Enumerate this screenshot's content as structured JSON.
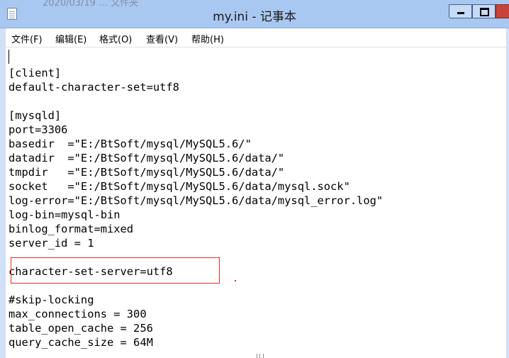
{
  "window": {
    "title": "my.ini - 记事本",
    "ghost_title": "2020/03/19 … 文件夹",
    "icon": "notepad-icon"
  },
  "menu": {
    "items": [
      {
        "label": "文件(F)"
      },
      {
        "label": "编辑(E)"
      },
      {
        "label": "格式(O)"
      },
      {
        "label": "查看(V)"
      },
      {
        "label": "帮助(H)"
      }
    ]
  },
  "editor": {
    "lines": [
      "",
      "[client]",
      "default-character-set=utf8",
      "",
      "[mysqld]",
      "port=3306",
      "basedir  =\"E:/BtSoft/mysql/MySQL5.6/\"",
      "datadir  =\"E:/BtSoft/mysql/MySQL5.6/data/\"",
      "tmpdir   =\"E:/BtSoft/mysql/MySQL5.6/data/\"",
      "socket   =\"E:/BtSoft/mysql/MySQL5.6/data/mysql.sock\"",
      "log-error=\"E:/BtSoft/mysql/MySQL5.6/data/mysql_error.log\"",
      "log-bin=mysql-bin",
      "binlog_format=mixed",
      "server_id = 1",
      "",
      "character-set-server=utf8",
      "",
      "#skip-locking",
      "max_connections = 300",
      "table_open_cache = 256",
      "query_cache_size = 64M"
    ],
    "highlight_color": "#e03030"
  }
}
